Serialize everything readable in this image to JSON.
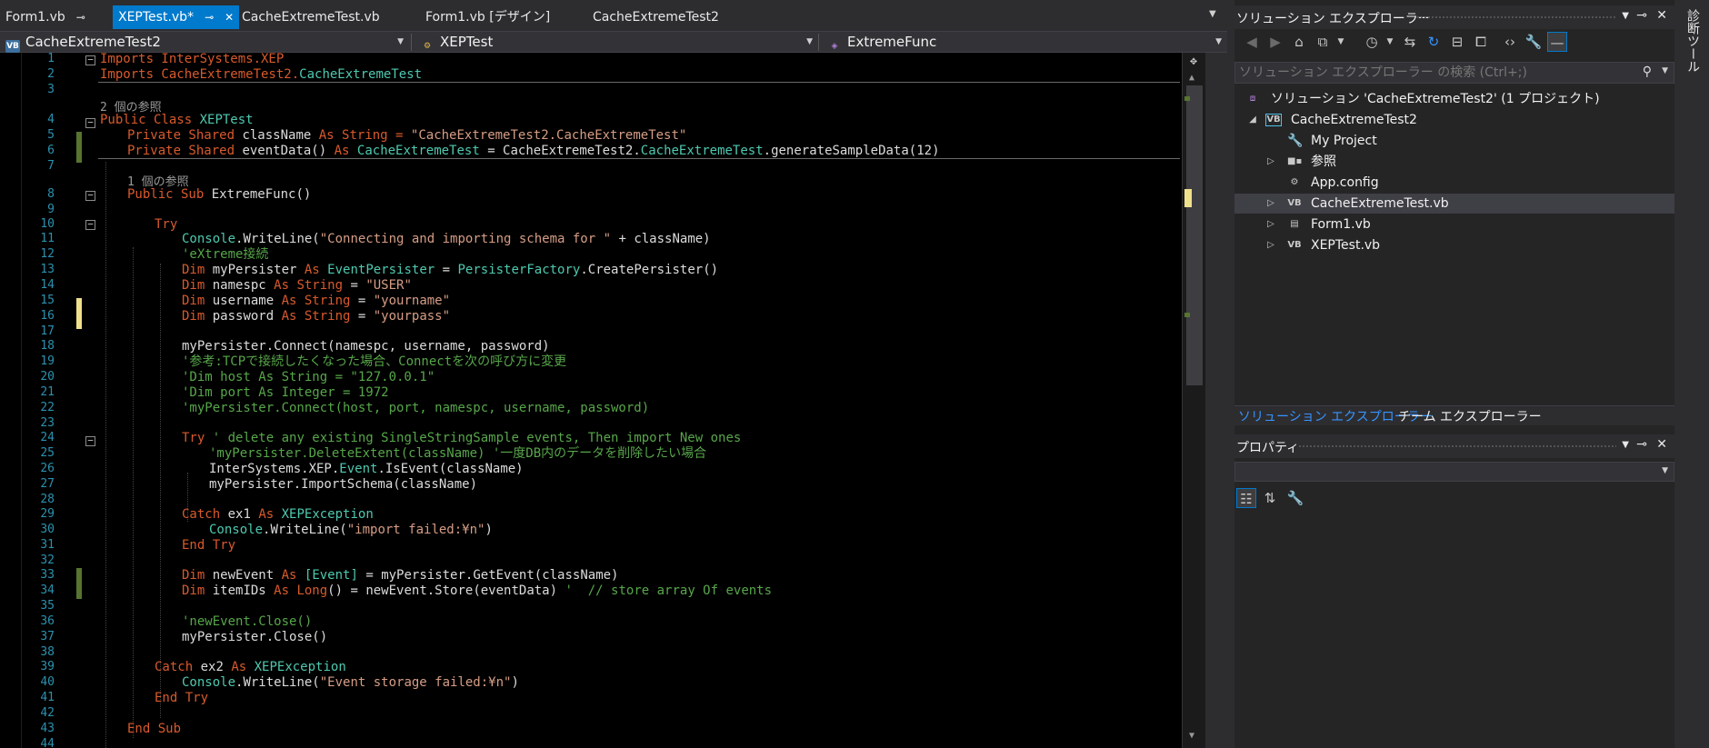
{
  "tabs": [
    {
      "label": "Form1.vb",
      "pinned": true,
      "active": false
    },
    {
      "label": "XEPTest.vb*",
      "pinned": true,
      "active": true
    },
    {
      "label": "CacheExtremeTest.vb",
      "active": false
    },
    {
      "label": "Form1.vb [デザイン]",
      "active": false
    },
    {
      "label": "CacheExtremeTest2",
      "active": false
    }
  ],
  "navbar": {
    "project": "CacheExtremeTest2",
    "class": "XEPTest",
    "member": "ExtremeFunc"
  },
  "editor": {
    "codelens": [
      "2 個の参照",
      "1 個の参照"
    ],
    "line_numbers": [
      "1",
      "2",
      "3",
      "4",
      "5",
      "6",
      "7",
      "8",
      "9",
      "10",
      "11",
      "12",
      "13",
      "14",
      "15",
      "16",
      "17",
      "18",
      "19",
      "20",
      "21",
      "22",
      "23",
      "24",
      "25",
      "26",
      "27",
      "28",
      "29",
      "30",
      "31",
      "32",
      "33",
      "34",
      "35",
      "36",
      "37",
      "38",
      "39",
      "40",
      "41",
      "42",
      "43",
      "44"
    ],
    "lines": {
      "l1": "Imports InterSystems.XEP",
      "l2a": "Imports CacheExtremeTest2.",
      "l2b": "CacheExtremeTest",
      "l4a": "Public Class",
      "l4b": "XEPTest",
      "l5a": "Private Shared",
      "l5b": "className",
      "l5c": "As String =",
      "l5d": "\"CacheExtremeTest2.CacheExtremeTest\"",
      "l6a": "Private Shared",
      "l6b": "eventData() ",
      "l6c": "As",
      "l6d": "CacheExtremeTest",
      "l6e": " = CacheExtremeTest2.",
      "l6f": "CacheExtremeTest",
      "l6g": ".generateSampleData(12)",
      "l8a": "Public Sub",
      "l8b": "ExtremeFunc()",
      "l10": "Try",
      "l11a": "Console",
      "l11b": ".WriteLine(",
      "l11c": "\"Connecting and importing schema for \"",
      "l11d": " + className)",
      "l12": "'eXtreme接続",
      "l13a": "Dim",
      "l13b": " myPersister ",
      "l13c": "As",
      "l13d": "EventPersister",
      "l13e": " = ",
      "l13f": "PersisterFactory",
      "l13g": ".CreatePersister()",
      "l14a": "Dim",
      "l14b": " namespc ",
      "l14c": "As String",
      "l14d": " = ",
      "l14e": "\"USER\"",
      "l15a": "Dim",
      "l15b": " username ",
      "l15c": "As String",
      "l15d": " = ",
      "l15e": "\"yourname\"",
      "l16a": "Dim",
      "l16b": " password ",
      "l16c": "As String",
      "l16d": " = ",
      "l16e": "\"yourpass\"",
      "l18": "myPersister.Connect(namespc, username, password)",
      "l19": "'参考:TCPで接続したくなった場合、Connectを次の呼び方に変更",
      "l20": "'Dim host As String = \"127.0.0.1\"",
      "l21": "'Dim port As Integer = 1972",
      "l22": "'myPersister.Connect(host, port, namespc, username, password)",
      "l24a": "Try",
      "l24b": " ' delete any existing SingleStringSample events, Then import New ones",
      "l25": "'myPersister.DeleteExtent(className) '一度DB内のデータを削除したい場合",
      "l26a": "InterSystems.XEP.",
      "l26b": "Event",
      "l26c": ".IsEvent(className)",
      "l27": "myPersister.ImportSchema(className)",
      "l29a": "Catch",
      "l29b": " ex1 ",
      "l29c": "As",
      "l29d": "XEPException",
      "l30a": "Console",
      "l30b": ".WriteLine(",
      "l30c": "\"import failed:¥n\"",
      "l30d": ")",
      "l31": "End Try",
      "l33a": "Dim",
      "l33b": " newEvent ",
      "l33c": "As",
      "l33d": "[Event]",
      "l33e": " = myPersister.GetEvent(className)",
      "l34a": "Dim",
      "l34b": " itemIDs ",
      "l34c": "As Long",
      "l34d": "() = newEvent.Store(eventData) ",
      "l34e": "'  // store array Of events",
      "l36": "'newEvent.Close()",
      "l37": "myPersister.Close()",
      "l39a": "Catch",
      "l39b": " ex2 ",
      "l39c": "As",
      "l39d": "XEPException",
      "l40a": "Console",
      "l40b": ".WriteLine(",
      "l40c": "\"Event storage failed:¥n\"",
      "l40d": ")",
      "l41": "End Try",
      "l43": "End Sub"
    }
  },
  "solution_explorer": {
    "title": "ソリューション エクスプローラー",
    "search_placeholder": "ソリューション エクスプローラー の検索 (Ctrl+;)",
    "solution": "ソリューション 'CacheExtremeTest2' (1 プロジェクト)",
    "project": "CacheExtremeTest2",
    "items": [
      {
        "label": "My Project",
        "icon": "wrench-icon"
      },
      {
        "label": "参照",
        "icon": "references-icon",
        "expandable": true
      },
      {
        "label": "App.config",
        "icon": "config-file-icon"
      },
      {
        "label": "CacheExtremeTest.vb",
        "icon": "vb-file-icon",
        "expandable": true,
        "selected": true
      },
      {
        "label": "Form1.vb",
        "icon": "form-icon",
        "expandable": true
      },
      {
        "label": "XEPTest.vb",
        "icon": "vb-file-icon",
        "expandable": true
      }
    ],
    "bottom_tabs": [
      "ソリューション エクスプローラー",
      "チーム エクスプローラー"
    ]
  },
  "properties": {
    "title": "プロパティ"
  },
  "side_tab": "診断ツール",
  "colors": {
    "accent": "#007acc",
    "editor_bg": "#000000",
    "keyword": "#569cd6",
    "type": "#4ec9b0",
    "string": "#d69d85",
    "comment": "#57a64a"
  }
}
